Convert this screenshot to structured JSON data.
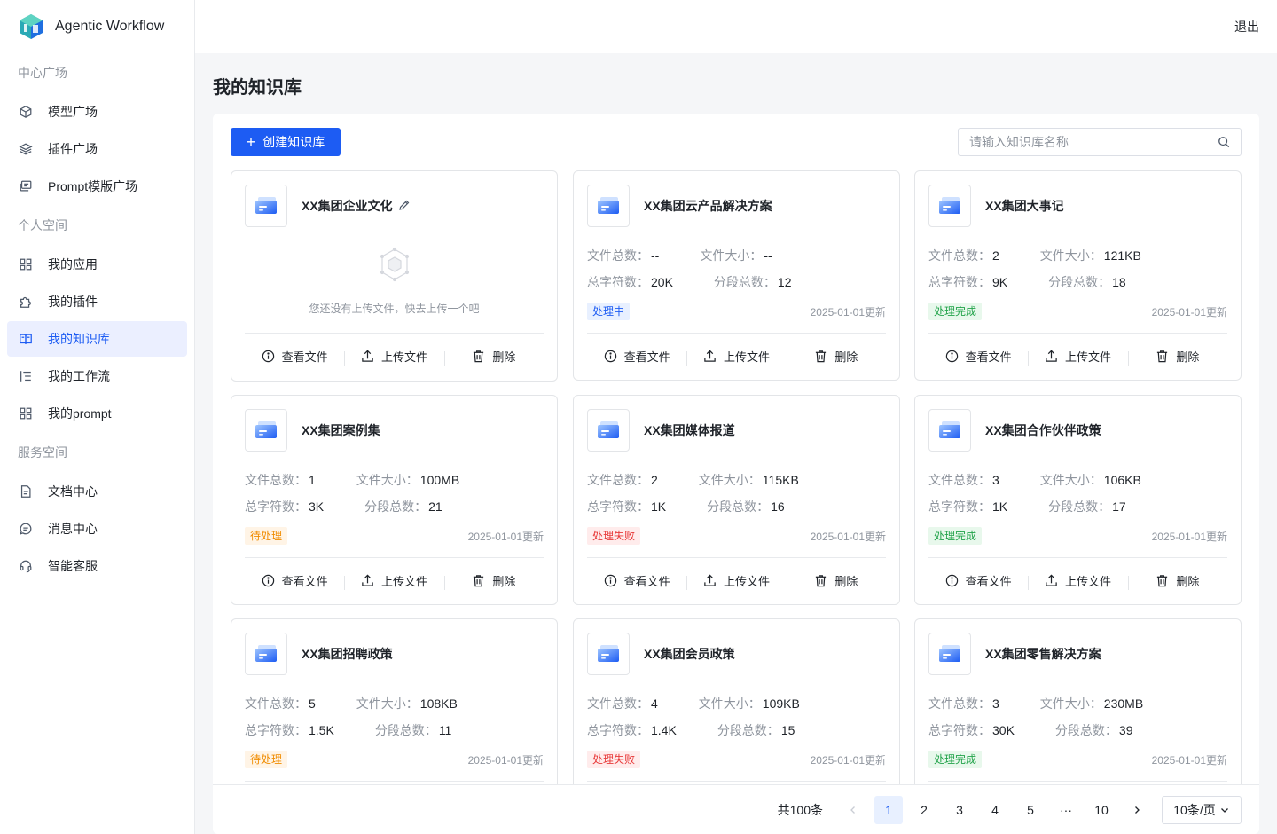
{
  "app": {
    "name": "Agentic Workflow"
  },
  "header": {
    "logout_label": "退出"
  },
  "sidebar": {
    "sections": [
      {
        "title": "中心广场",
        "items": [
          {
            "label": "模型广场",
            "icon": "cube-icon"
          },
          {
            "label": "插件广场",
            "icon": "layers-icon"
          },
          {
            "label": "Prompt模版广场",
            "icon": "prompt-icon"
          }
        ]
      },
      {
        "title": "个人空间",
        "items": [
          {
            "label": "我的应用",
            "icon": "grid-icon"
          },
          {
            "label": "我的插件",
            "icon": "puzzle-icon"
          },
          {
            "label": "我的知识库",
            "icon": "book-icon",
            "active": true
          },
          {
            "label": "我的工作流",
            "icon": "workflow-icon"
          },
          {
            "label": "我的prompt",
            "icon": "grid-icon"
          }
        ]
      },
      {
        "title": "服务空间",
        "items": [
          {
            "label": "文档中心",
            "icon": "document-icon"
          },
          {
            "label": "消息中心",
            "icon": "message-icon"
          },
          {
            "label": "智能客服",
            "icon": "headset-icon"
          }
        ]
      }
    ]
  },
  "page": {
    "title": "我的知识库",
    "create_label": "创建知识库",
    "search_placeholder": "请输入知识库名称"
  },
  "labels": {
    "file_count": "文件总数：",
    "file_size": "文件大小：",
    "char_count": "总字符数：",
    "segment_count": "分段总数：",
    "view_files": "查看文件",
    "upload_files": "上传文件",
    "delete": "删除",
    "empty_text": "您还没有上传文件，快去上传一个吧"
  },
  "status_colors": {
    "processing": "#1d5cf3",
    "done": "#22a34a",
    "pending": "#f08c00",
    "failed": "#e83a3a"
  },
  "cards": [
    {
      "title": "XX集团企业文化",
      "empty": true,
      "editable": true
    },
    {
      "title": "XX集团云产品解决方案",
      "file_count": "--",
      "file_size": "--",
      "char_count": "20K",
      "segment_count": "12",
      "status": "处理中",
      "status_type": "processing",
      "updated": "2025-01-01更新"
    },
    {
      "title": "XX集团大事记",
      "file_count": "2",
      "file_size": "121KB",
      "char_count": "9K",
      "segment_count": "18",
      "status": "处理完成",
      "status_type": "done",
      "updated": "2025-01-01更新"
    },
    {
      "title": "XX集团案例集",
      "file_count": "1",
      "file_size": "100MB",
      "char_count": "3K",
      "segment_count": "21",
      "status": "待处理",
      "status_type": "pending",
      "updated": "2025-01-01更新"
    },
    {
      "title": "XX集团媒体报道",
      "file_count": "2",
      "file_size": "115KB",
      "char_count": "1K",
      "segment_count": "16",
      "status": "处理失败",
      "status_type": "failed",
      "updated": "2025-01-01更新"
    },
    {
      "title": "XX集团合作伙伴政策",
      "file_count": "3",
      "file_size": "106KB",
      "char_count": "1K",
      "segment_count": "17",
      "status": "处理完成",
      "status_type": "done",
      "updated": "2025-01-01更新"
    },
    {
      "title": "XX集团招聘政策",
      "file_count": "5",
      "file_size": "108KB",
      "char_count": "1.5K",
      "segment_count": "11",
      "status": "待处理",
      "status_type": "pending",
      "updated": "2025-01-01更新"
    },
    {
      "title": "XX集团会员政策",
      "file_count": "4",
      "file_size": "109KB",
      "char_count": "1.4K",
      "segment_count": "15",
      "status": "处理失败",
      "status_type": "failed",
      "updated": "2025-01-01更新"
    },
    {
      "title": "XX集团零售解决方案",
      "file_count": "3",
      "file_size": "230MB",
      "char_count": "30K",
      "segment_count": "39",
      "status": "处理完成",
      "status_type": "done",
      "updated": "2025-01-01更新"
    }
  ],
  "pagination": {
    "total_label": "共100条",
    "pages": [
      "1",
      "2",
      "3",
      "4",
      "5",
      "···",
      "10"
    ],
    "current": "1",
    "page_size_label": "10条/页"
  }
}
